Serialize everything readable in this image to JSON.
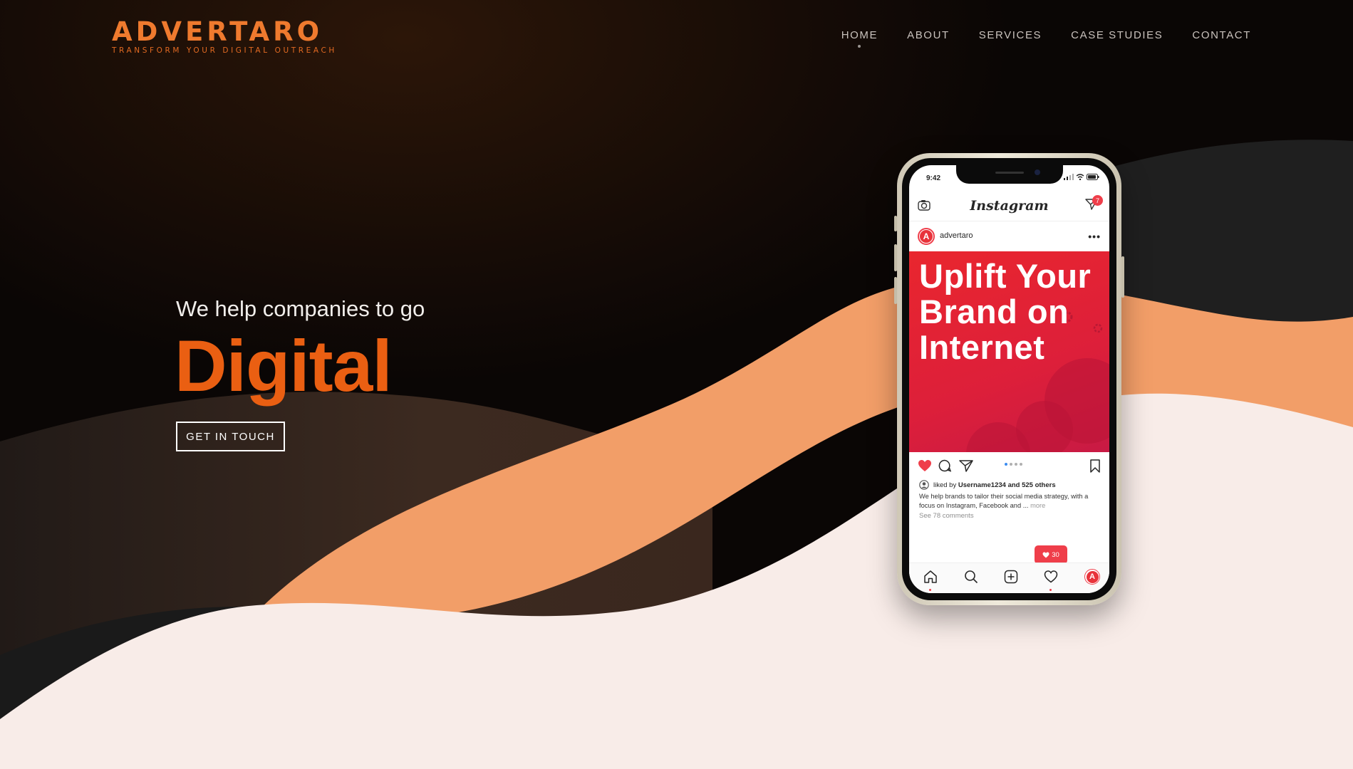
{
  "brand": {
    "name": "ADVERTARO",
    "tagline": "TRANSFORM YOUR DIGITAL OUTREACH",
    "accent": "#ea5f12"
  },
  "nav": {
    "items": [
      {
        "label": "HOME",
        "active": true
      },
      {
        "label": "ABOUT",
        "active": false
      },
      {
        "label": "SERVICES",
        "active": false
      },
      {
        "label": "CASE STUDIES",
        "active": false
      },
      {
        "label": "CONTACT",
        "active": false
      }
    ]
  },
  "hero": {
    "subtitle": "We help companies to go",
    "title": "Digital",
    "cta_label": "GET IN TOUCH"
  },
  "phone": {
    "status_time": "9:42",
    "app_name": "Instagram",
    "dm_badge": "7",
    "post": {
      "username": "advertaro",
      "avatar_letter": "A",
      "image_text": "Uplift Your Brand on Internet",
      "liked_by_prefix": "liked by",
      "liked_by": "Username1234 and 525 others",
      "caption": "We help brands to tailor their social media strategy, with a focus on Instagram, Facebook and ...",
      "caption_more": "more",
      "comments_link": "See 78 comments",
      "like_notification_count": "30"
    }
  },
  "colors": {
    "wave_orange": "#f29e68",
    "wave_cream": "#f8ece8",
    "wave_dark": "#1e1e1e",
    "instagram_red": "#ef3e4a"
  }
}
